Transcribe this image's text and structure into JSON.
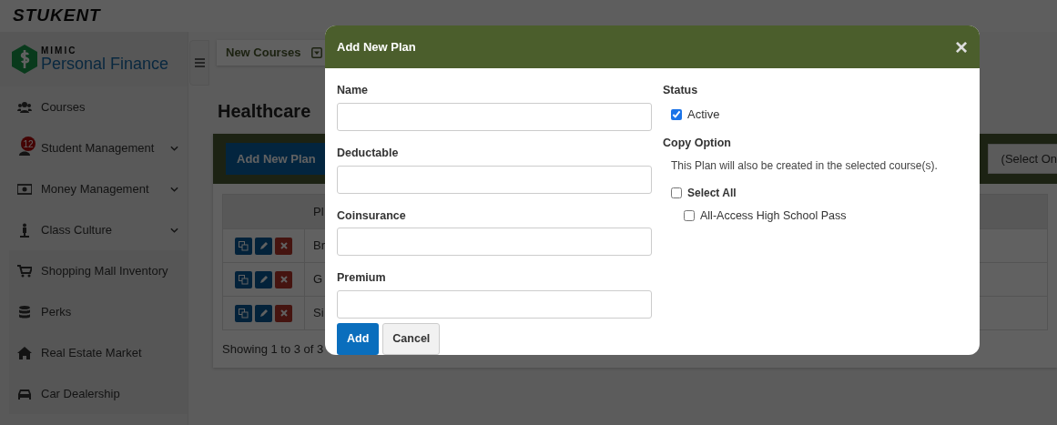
{
  "brand": {
    "company": "STUKENT",
    "product_tag": "MIMIC",
    "product": "Personal Finance"
  },
  "sidebar": {
    "items": [
      {
        "label": "Courses",
        "expandable": false
      },
      {
        "label": "Student Management",
        "expandable": true,
        "badge": "12"
      },
      {
        "label": "Money Management",
        "expandable": true
      },
      {
        "label": "Class Culture",
        "expandable": true
      }
    ],
    "tools": [
      {
        "label": "Shopping Mall Inventory"
      },
      {
        "label": "Perks"
      },
      {
        "label": "Real Estate Market"
      },
      {
        "label": "Car Dealership"
      }
    ]
  },
  "topbar": {
    "course_menu": "New Courses"
  },
  "page": {
    "title": "Healthcare",
    "add_button": "Add New Plan",
    "course_select": "(Select On"
  },
  "table": {
    "columns": [
      "Pl"
    ],
    "rows": [
      {
        "name": "Br"
      },
      {
        "name": "G"
      },
      {
        "name": "Si"
      }
    ],
    "footer": "Showing 1 to 3 of 3"
  },
  "modal": {
    "title": "Add New Plan",
    "close": "×",
    "fields": [
      {
        "label": "Name"
      },
      {
        "label": "Deductable"
      },
      {
        "label": "Coinsurance"
      },
      {
        "label": "Premium"
      }
    ],
    "status": {
      "label": "Status",
      "option": {
        "label": "Active",
        "checked": true
      }
    },
    "copy": {
      "label": "Copy Option",
      "note": "This Plan will also be created in the selected course(s).",
      "select_all": {
        "label": "Select All",
        "checked": false
      },
      "courses": [
        {
          "label": "All-Access High School Pass",
          "checked": false
        }
      ]
    },
    "buttons": {
      "add": "Add",
      "cancel": "Cancel"
    }
  }
}
